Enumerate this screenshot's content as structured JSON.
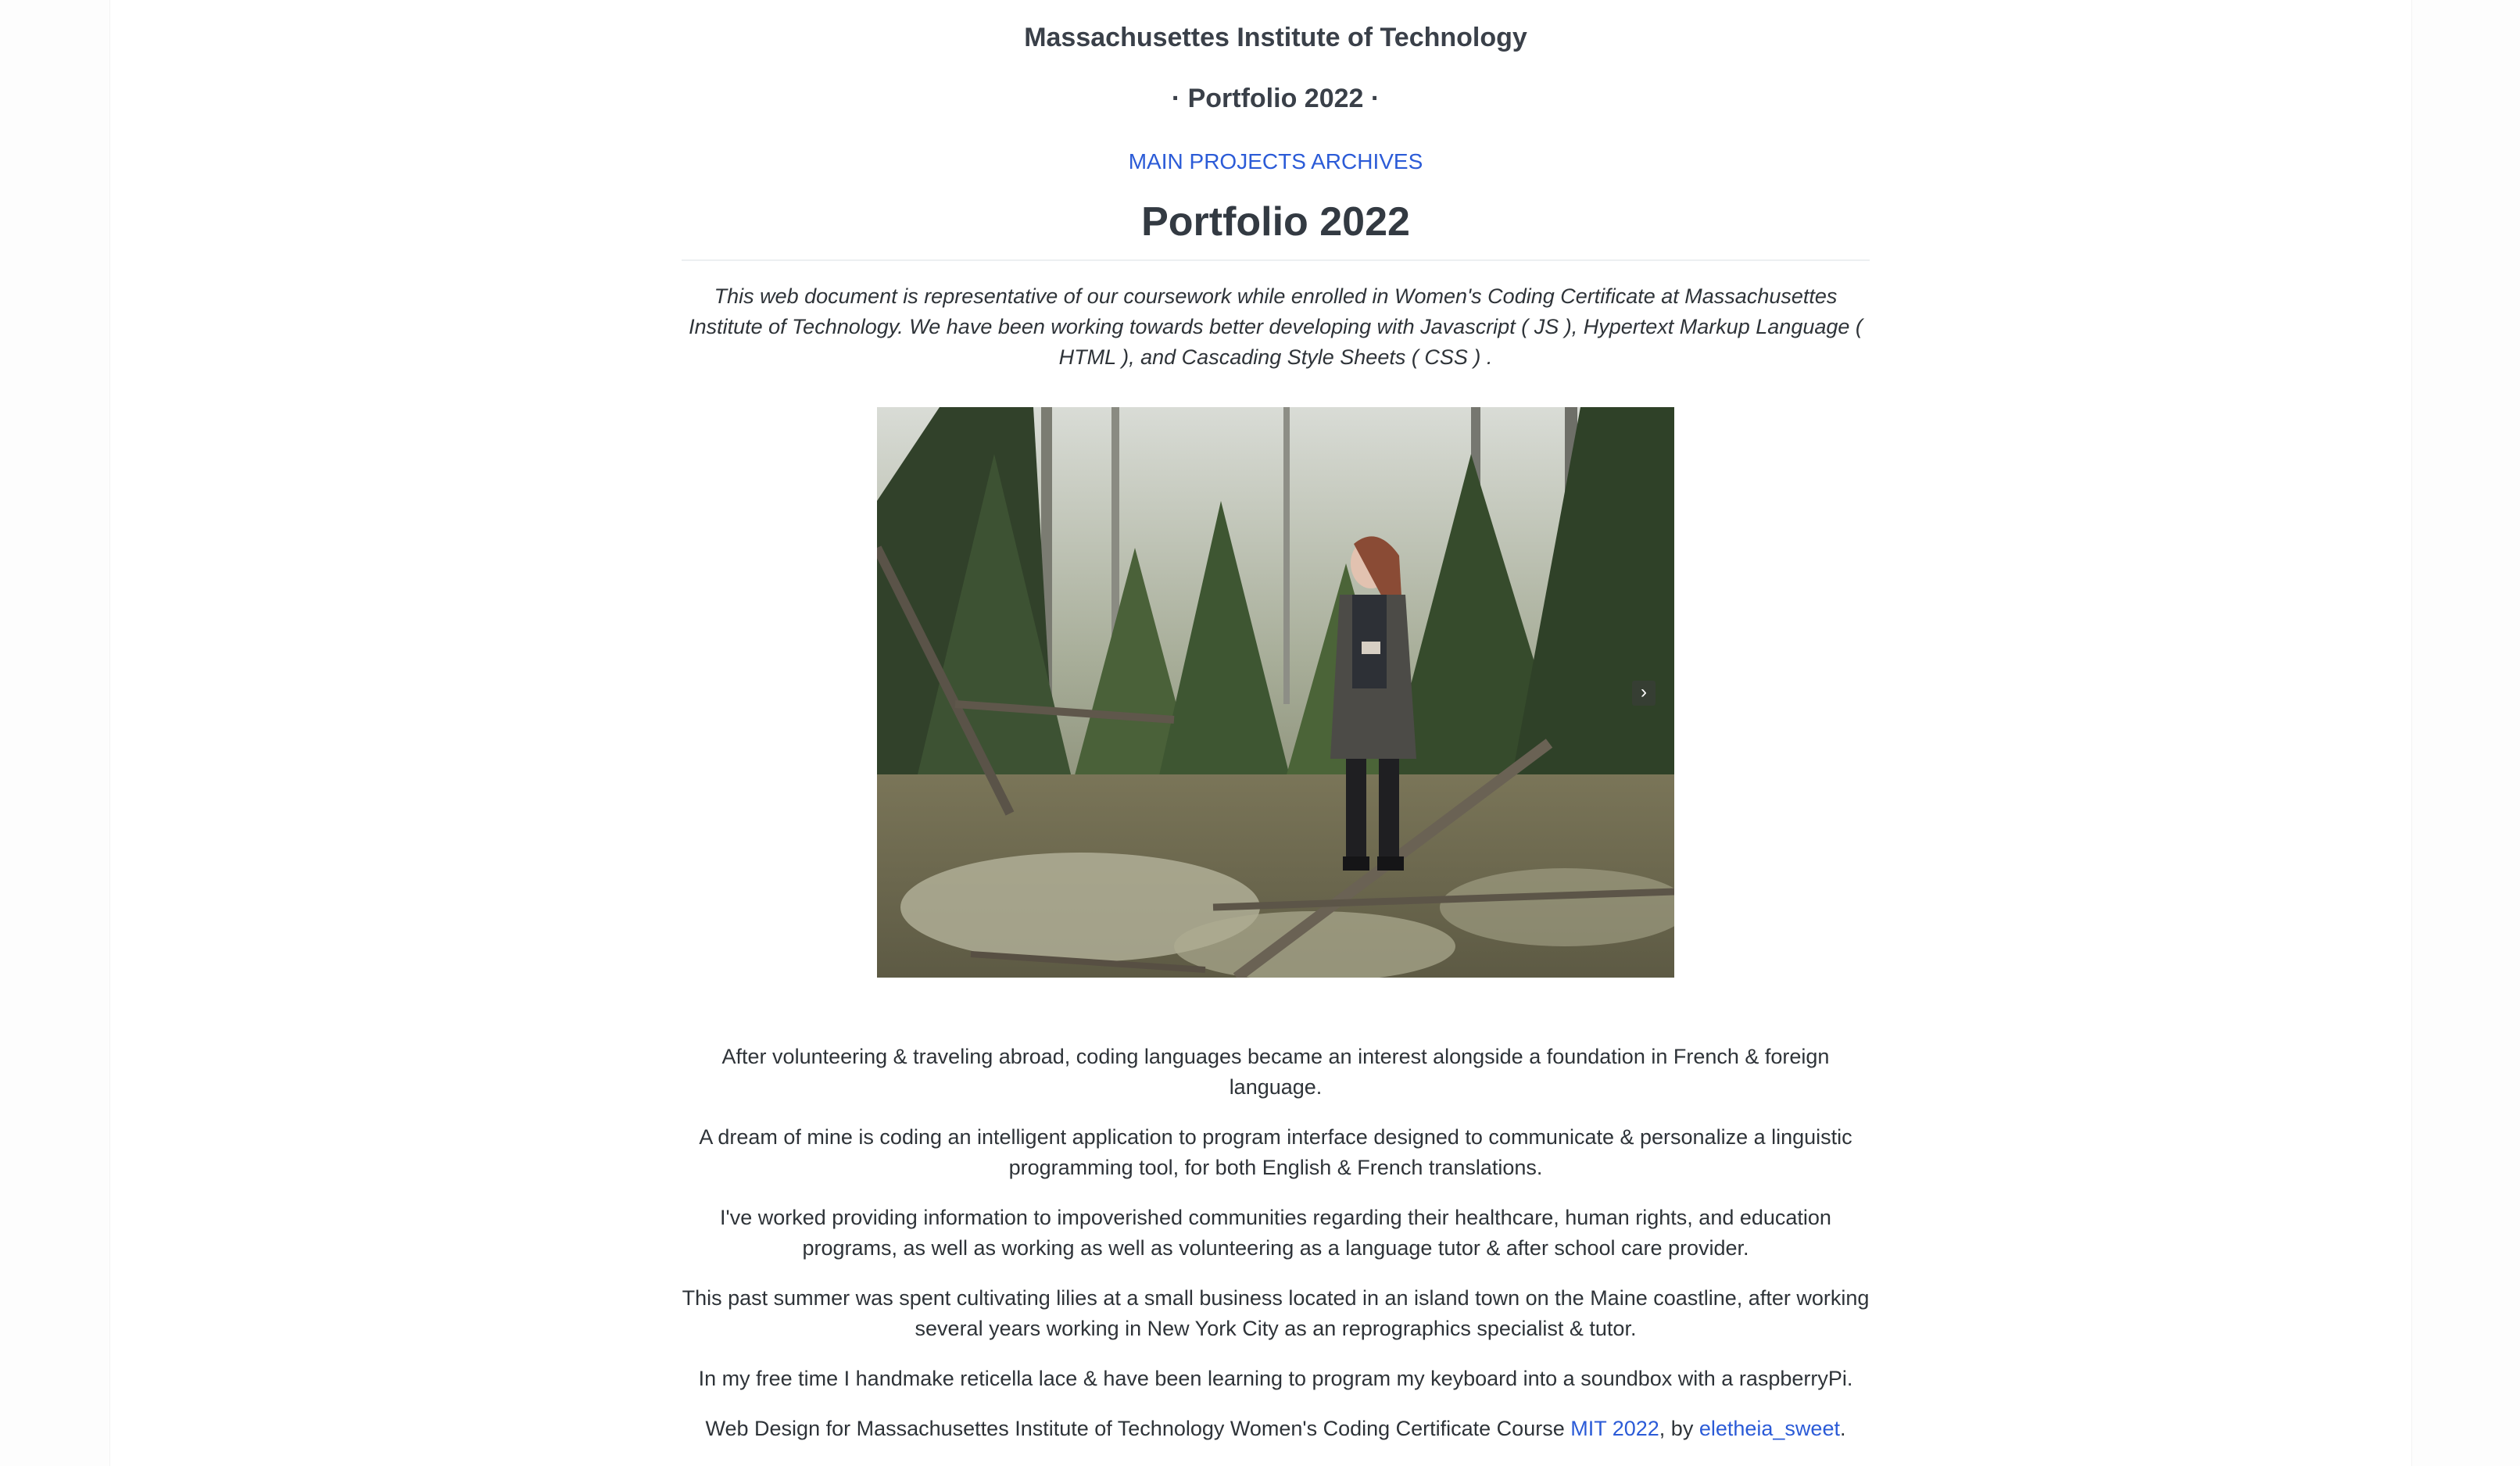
{
  "header": {
    "site_title": "Massachusettes Institute of Technology",
    "site_subtitle": "· Portfolio 2022 ·",
    "nav_link": "MAIN PROJECTS ARCHIVES"
  },
  "main": {
    "heading": "Portfolio 2022",
    "intro": "This web document is representative of our coursework while enrolled in Women's Coding Certificate at Massachusettes Institute of Technology. We have been working towards better developing with Javascript ( JS ), Hypertext Markup Language ( HTML ), and Cascading Style Sheets ( CSS ) .",
    "carousel": {
      "next_icon": "chevron-right-icon"
    },
    "bio": [
      "After volunteering & traveling abroad, coding languages became an interest alongside a foundation in French & foreign language.",
      "A dream of mine is coding an intelligent application to program interface designed to communicate & personalize a linguistic programming tool, for both English & French translations.",
      "I've worked providing information to impoverished communities regarding their healthcare, human rights, and education programs, as well as working as well as volunteering as a language tutor & after school care provider.",
      "This past summer was spent cultivating lilies at a small business located in an island town on the Maine coastline, after working several years working in New York City as an reprographics specialist & tutor.",
      "In my free time I handmake reticella lace & have been learning to program my keyboard into a soundbox with a raspberryPi."
    ],
    "footer": {
      "prefix": "Web Design for Massachusettes Institute of Technology Women's Coding Certificate Course ",
      "link1": "MIT 2022",
      "middle": ", by ",
      "link2": "eletheia_sweet",
      "suffix": "."
    }
  },
  "colors": {
    "link": "#2b5bd7",
    "heading": "#333a42",
    "text": "#2e3338"
  }
}
